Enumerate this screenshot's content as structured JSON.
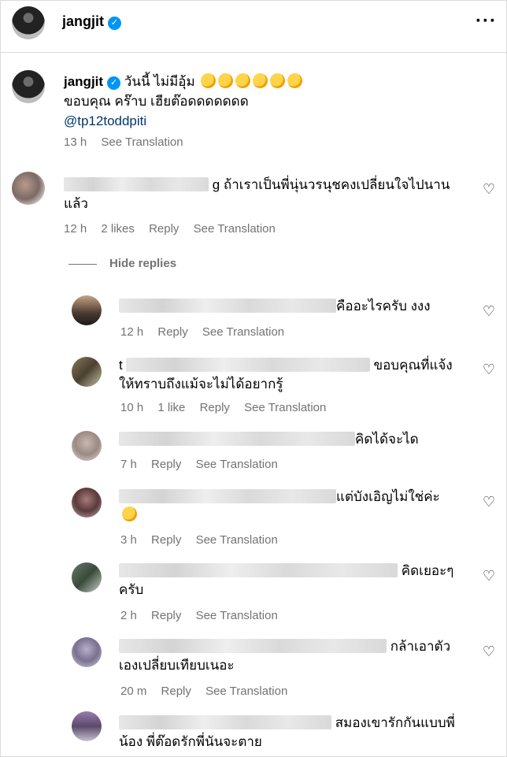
{
  "header": {
    "username": "jangjit",
    "more_icon": "more-icon"
  },
  "caption": {
    "username": "jangjit",
    "line1": "วันนี้ ไม่มีอุ้ม",
    "emoji_count": 6,
    "line2": "ขอบคุณ คร๊าบ เฮียต๊อดดดดดดด",
    "mention": "@tp12toddpiti",
    "time": "13 h",
    "see_translation": "See Translation"
  },
  "top_comment": {
    "text_line1": "g ถ้าเราเป็นพี่นุ่นวรนุชคงเปลี่ยนใจไปนาน",
    "text_line2": "แล้ว",
    "time": "12 h",
    "likes": "2 likes",
    "reply": "Reply",
    "see_translation": "See Translation"
  },
  "hide_replies": "Hide replies",
  "replies": [
    {
      "line1": "คืออะไรครับ งงง",
      "line2": "",
      "time": "12 h",
      "likes": "",
      "reply": "Reply",
      "see_translation": "See Translation"
    },
    {
      "prefix": "t",
      "line1": "ขอบคุณที่แจ้ง",
      "line2": "ให้ทราบถึงแม้จะไม่ได้อยากรู้",
      "time": "10 h",
      "likes": "1 like",
      "reply": "Reply",
      "see_translation": "See Translation"
    },
    {
      "line1": "คิดได้จะได",
      "line2": "",
      "time": "7 h",
      "likes": "",
      "reply": "Reply",
      "see_translation": "See Translation"
    },
    {
      "line1": "แต่บังเอิญไม่ใช่ค่ะ",
      "line2": "",
      "time": "3 h",
      "likes": "",
      "reply": "Reply",
      "see_translation": "See Translation"
    },
    {
      "line1": "คิดเยอะๆ",
      "line2": "ครับ",
      "time": "2 h",
      "likes": "",
      "reply": "Reply",
      "see_translation": "See Translation"
    },
    {
      "line1": "กล้าเอาตัว",
      "line2": "เองเปลี่ยบเทียบเนอะ",
      "time": "20 m",
      "likes": "",
      "reply": "Reply",
      "see_translation": "See Translation"
    },
    {
      "line1": "สมองเขารักกันแบบพี่",
      "line2": "น้อง พี่ต๊อดรักพี่นันจะตาย",
      "time": "",
      "likes": "",
      "reply": "",
      "see_translation": ""
    }
  ]
}
